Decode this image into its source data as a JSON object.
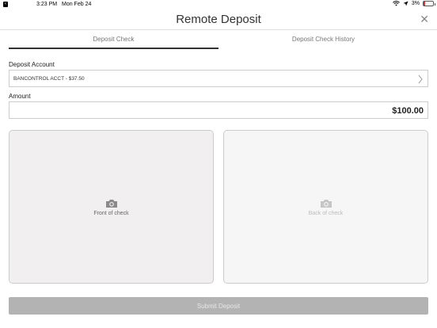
{
  "status_bar": {
    "time": "3:23 PM",
    "date": "Mon Feb 24",
    "battery": "3%",
    "battery_level": 0.03
  },
  "header": {
    "title": "Remote Deposit",
    "close_glyph": "✕"
  },
  "tabs": [
    {
      "label": "Deposit Check",
      "active": true
    },
    {
      "label": "Deposit Check History",
      "active": false
    }
  ],
  "form": {
    "account_label": "Deposit Account",
    "account_value": "BANCONTROL ACCT - $37.50",
    "amount_label": "Amount",
    "amount_value": "$100.00"
  },
  "checks": {
    "front_caption": "Front of check",
    "back_caption": "Back of check"
  },
  "submit_label": "Submit Deposit",
  "icons": {
    "camera": "camera-icon",
    "chevron": "chevron-right-icon",
    "close": "close-icon",
    "wifi": "wifi-icon",
    "location": "location-arrow-icon",
    "battery": "battery-icon"
  },
  "colors": {
    "active_tab_underline": "#333333",
    "submit_disabled": "#b3b3b3",
    "battery_low": "#dd3333"
  }
}
